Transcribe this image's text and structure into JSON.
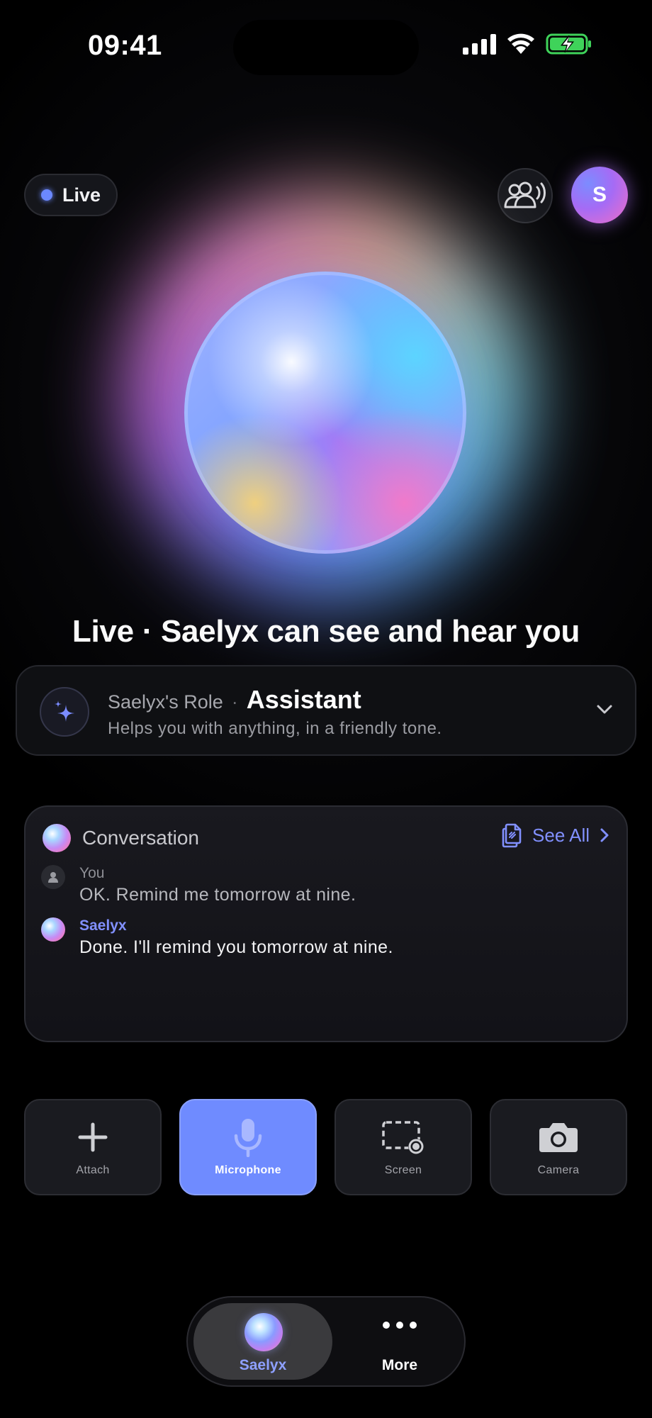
{
  "status_bar": {
    "time": "09:41"
  },
  "header": {
    "live_label": "Live",
    "avatar_initial": "S"
  },
  "headline": "Live · Saelyx can see and hear you",
  "role": {
    "prefix": "Saelyx's Role",
    "separator": "·",
    "name": "Assistant",
    "description": "Helps you with anything, in a friendly tone."
  },
  "conversation": {
    "title": "Conversation",
    "see_all_label": "See All",
    "messages": [
      {
        "sender": "You",
        "text": "OK. Remind me tomorrow at nine."
      },
      {
        "sender": "Saelyx",
        "text": "Done. I'll remind you tomorrow at nine."
      }
    ]
  },
  "actions": [
    {
      "label": "Attach",
      "icon": "plus-icon",
      "active": false
    },
    {
      "label": "Microphone",
      "icon": "microphone-icon",
      "active": true
    },
    {
      "label": "Screen",
      "icon": "screen-record-icon",
      "active": false
    },
    {
      "label": "Camera",
      "icon": "camera-icon",
      "active": false
    }
  ],
  "tab_bar": {
    "tabs": [
      {
        "label": "Saelyx",
        "icon": "saelyx-orb-icon",
        "selected": true
      },
      {
        "label": "More",
        "icon": "more-dots-icon",
        "selected": false
      }
    ]
  },
  "colors": {
    "accent": "#6f8bff",
    "accent_text": "#8190ff",
    "background": "#000000",
    "battery": "#3fd35a"
  }
}
